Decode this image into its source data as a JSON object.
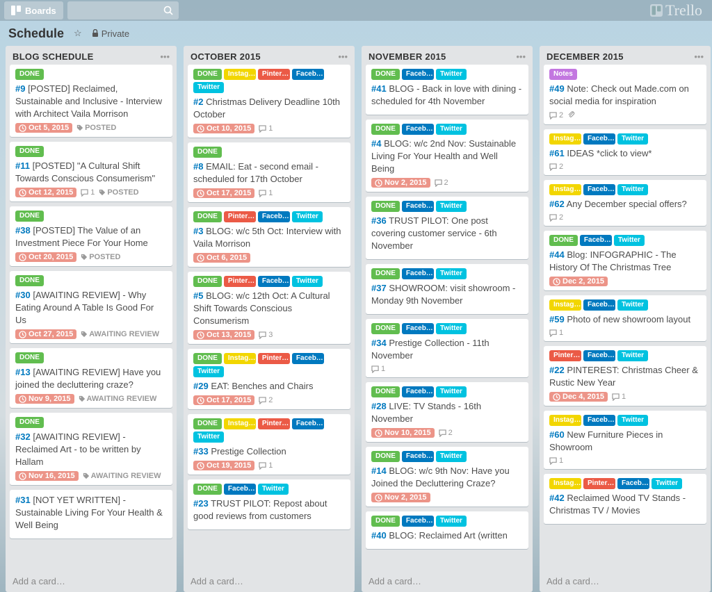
{
  "header": {
    "boards": "Boards",
    "logo": "Trello"
  },
  "board": {
    "title": "Schedule",
    "privacy": "Private",
    "add_card": "Add a card…"
  },
  "lists": [
    {
      "title": "BLOG SCHEDULE",
      "cards": [
        {
          "labels": [
            "done"
          ],
          "num": "#9",
          "title": "[POSTED] Reclaimed, Sustainable and Inclusive - Interview with Architect Vaila Morrison",
          "due": "Oct 5, 2015",
          "tag": "POSTED"
        },
        {
          "labels": [
            "done"
          ],
          "num": "#11",
          "title": "[POSTED] \"A Cultural Shift Towards Conscious Consumerism\"",
          "due": "Oct 12, 2015",
          "comments": 1,
          "tag": "POSTED"
        },
        {
          "labels": [
            "done"
          ],
          "num": "#38",
          "title": "[POSTED] The Value of an Investment Piece For Your Home",
          "due": "Oct 20, 2015",
          "tag": "POSTED"
        },
        {
          "labels": [
            "done"
          ],
          "num": "#30",
          "title": "[AWAITING REVIEW] - Why Eating Around A Table Is Good For Us",
          "due": "Oct 27, 2015",
          "tag": "AWAITING REVIEW"
        },
        {
          "labels": [
            "done"
          ],
          "num": "#13",
          "title": "[AWAITING REVIEW] Have you joined the decluttering craze?",
          "due": "Nov 9, 2015",
          "tag": "AWAITING REVIEW"
        },
        {
          "labels": [
            "done"
          ],
          "num": "#32",
          "title": "[AWAITING REVIEW] - Reclaimed Art - to be written by Hallam",
          "due": "Nov 16, 2015",
          "tag": "AWAITING REVIEW"
        },
        {
          "labels": [],
          "num": "#31",
          "title": "[NOT YET WRITTEN] - Sustainable Living For Your Health & Well Being"
        }
      ]
    },
    {
      "title": "OCTOBER 2015",
      "cards": [
        {
          "labels": [
            "done",
            "instag",
            "pinter",
            "faceb",
            "twitter"
          ],
          "num": "#2",
          "title": "Christmas Delivery Deadline 10th October",
          "due": "Oct 10, 2015",
          "comments": 1
        },
        {
          "labels": [
            "done"
          ],
          "num": "#8",
          "title": "EMAIL: Eat - second email - scheduled for 17th October",
          "due": "Oct 17, 2015",
          "comments": 1
        },
        {
          "labels": [
            "done",
            "pinter",
            "faceb",
            "twitter"
          ],
          "num": "#3",
          "title": "BLOG: w/c 5th Oct: Interview with Vaila Morrison",
          "due": "Oct 6, 2015"
        },
        {
          "labels": [
            "done",
            "pinter",
            "faceb",
            "twitter"
          ],
          "num": "#5",
          "title": "BLOG: w/c 12th Oct: A Cultural Shift Towards Conscious Consumerism",
          "due": "Oct 13, 2015",
          "comments": 3
        },
        {
          "labels": [
            "done",
            "instag",
            "pinter",
            "faceb",
            "twitter"
          ],
          "num": "#29",
          "title": "EAT: Benches and Chairs",
          "due": "Oct 17, 2015",
          "comments": 2
        },
        {
          "labels": [
            "done",
            "instag",
            "pinter",
            "faceb",
            "twitter"
          ],
          "num": "#33",
          "title": "Prestige Collection",
          "due": "Oct 19, 2015",
          "comments": 1
        },
        {
          "labels": [
            "done",
            "faceb",
            "twitter"
          ],
          "num": "#23",
          "title": "TRUST PILOT: Repost about good reviews from customers"
        }
      ]
    },
    {
      "title": "NOVEMBER 2015",
      "cards": [
        {
          "labels": [
            "done",
            "faceb",
            "twitter"
          ],
          "num": "#41",
          "title": "BLOG - Back in love with dining - scheduled for 4th November"
        },
        {
          "labels": [
            "done",
            "faceb",
            "twitter"
          ],
          "num": "#4",
          "title": "BLOG: w/c 2nd Nov: Sustainable Living For Your Health and Well Being",
          "due": "Nov 2, 2015",
          "comments": 2
        },
        {
          "labels": [
            "done",
            "faceb",
            "twitter"
          ],
          "num": "#36",
          "title": "TRUST PILOT: One post covering customer service - 6th November"
        },
        {
          "labels": [
            "done",
            "faceb",
            "twitter"
          ],
          "num": "#37",
          "title": "SHOWROOM: visit showroom - Monday 9th November"
        },
        {
          "labels": [
            "done",
            "faceb",
            "twitter"
          ],
          "num": "#34",
          "title": "Prestige Collection - 11th November",
          "comments": 1
        },
        {
          "labels": [
            "done",
            "faceb",
            "twitter"
          ],
          "num": "#28",
          "title": "LIVE: TV Stands - 16th November",
          "due": "Nov 10, 2015",
          "comments": 2
        },
        {
          "labels": [
            "done",
            "faceb",
            "twitter"
          ],
          "num": "#14",
          "title": "BLOG: w/c 9th Nov: Have you Joined the Decluttering Craze?",
          "due": "Nov 2, 2015"
        },
        {
          "labels": [
            "done",
            "faceb",
            "twitter"
          ],
          "num": "#40",
          "title": "BLOG: Reclaimed Art (written"
        }
      ]
    },
    {
      "title": "DECEMBER 2015",
      "cards": [
        {
          "labels": [
            "notes"
          ],
          "num": "#49",
          "title": "Note: Check out Made.com on social media for inspiration",
          "comments": 2,
          "attach": true
        },
        {
          "labels": [
            "instag",
            "faceb",
            "twitter"
          ],
          "num": "#61",
          "title": "IDEAS *click to view*",
          "comments": 2
        },
        {
          "labels": [
            "instag",
            "faceb",
            "twitter"
          ],
          "num": "#62",
          "title": "Any December special offers?",
          "comments": 2
        },
        {
          "labels": [
            "done",
            "faceb",
            "twitter"
          ],
          "num": "#44",
          "title": "Blog: INFOGRAPHIC - The History Of The Christmas Tree",
          "due": "Dec 2, 2015"
        },
        {
          "labels": [
            "instag",
            "faceb",
            "twitter"
          ],
          "num": "#59",
          "title": "Photo of new showroom layout",
          "comments": 1
        },
        {
          "labels": [
            "pinter",
            "faceb",
            "twitter"
          ],
          "num": "#22",
          "title": "PINTEREST: Christmas Cheer & Rustic New Year",
          "due": "Dec 4, 2015",
          "comments": 1
        },
        {
          "labels": [
            "instag",
            "faceb",
            "twitter"
          ],
          "num": "#60",
          "title": "New Furniture Pieces in Showroom",
          "comments": 1
        },
        {
          "labels": [
            "instag",
            "pinter",
            "faceb",
            "twitter"
          ],
          "num": "#42",
          "title": "Reclaimed Wood TV Stands - Christmas TV / Movies"
        }
      ]
    }
  ],
  "label_text": {
    "done": "DONE",
    "instag": "Instag…",
    "pinter": "Pinter…",
    "faceb": "Faceb…",
    "twitter": "Twitter",
    "notes": "Notes"
  }
}
